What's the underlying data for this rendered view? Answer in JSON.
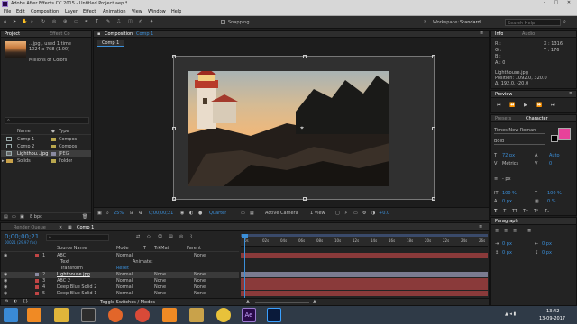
{
  "window": {
    "title": "Adobe After Effects CC 2015 - Untitled Project.aep *"
  },
  "menu": [
    "File",
    "Edit",
    "Composition",
    "Layer",
    "Effect",
    "Animation",
    "View",
    "Window",
    "Help"
  ],
  "toolbar": {
    "snapping": "Snapping",
    "workspace_label": "Workspace:",
    "workspace_value": "Standard",
    "search_placeholder": "Search Help"
  },
  "project": {
    "tabs": [
      "Project",
      "Effect Co"
    ],
    "asset_name": "...jpg , used 1 time",
    "asset_size": "1024 x 768 (1.00)",
    "asset_colors": "Millions of Colors",
    "columns": {
      "name": "Name",
      "type": "Type"
    },
    "items": [
      {
        "name": "Comp 1",
        "type": "Compos"
      },
      {
        "name": "Comp 2",
        "type": "Compos"
      },
      {
        "name": "Lighthou...jpg",
        "type": "JPEG"
      },
      {
        "name": "Solids",
        "type": "Folder"
      }
    ],
    "bpc": "8 bpc"
  },
  "composition": {
    "tab_label": "Composition",
    "tab_name": "Comp 1",
    "sub_tab": "Comp 1",
    "zoom": "25%",
    "timecode": "0;00;00;21",
    "resolution": "Quarter",
    "camera": "Active Camera",
    "view": "1 View",
    "exposure": "+0.0"
  },
  "info": {
    "tabs": [
      "Info",
      "Audio"
    ],
    "r": "R :",
    "g": "G :",
    "b": "B :",
    "a": "A : 0",
    "x": "X : 1316",
    "y": "Y : 176",
    "layer": "Lighthouse.jpg",
    "position": "Position: 1092.0, 320.0",
    "delta": "Δ: 192.0, -20.0"
  },
  "preview": {
    "tab": "Preview"
  },
  "character": {
    "tabs": [
      "Presets",
      "Character"
    ],
    "font": "Times New Roman",
    "style": "Bold",
    "size": "72 px",
    "leading": "Auto",
    "kerning": "Metrics",
    "tracking": "0",
    "stroke": "- px",
    "vscale": "100 %",
    "hscale": "100 %",
    "baseline": "0 px",
    "tsume": "0 %"
  },
  "paragraph": {
    "tab": "Paragraph",
    "indent_left": "0 px",
    "indent_right": "0 px",
    "space_before": "0 px",
    "space_after": "0 px"
  },
  "timeline": {
    "tabs": [
      "Render Queue",
      "Comp 1"
    ],
    "timecode": "0;00;00;21",
    "fps": "00021 (29.97 fps)",
    "columns": {
      "source": "Source Name",
      "mode": "Mode",
      "t": "T",
      "trkmat": "TrkMat",
      "parent": "Parent"
    },
    "layers": [
      {
        "num": "1",
        "name": "ABC",
        "mode": "Normal",
        "trkmat": "",
        "parent": "None",
        "color": "#c04545"
      },
      {
        "num": "",
        "name": "Text",
        "mode": "",
        "trkmat": "",
        "parent": "Animate:",
        "color": ""
      },
      {
        "num": "",
        "name": "Transform",
        "mode": "Reset",
        "trkmat": "",
        "parent": "",
        "color": ""
      },
      {
        "num": "2",
        "name": "Lighthouse.jpg",
        "mode": "Normal",
        "trkmat": "None",
        "parent": "None",
        "color": "#8a8aa0"
      },
      {
        "num": "3",
        "name": "ABC 2",
        "mode": "Normal",
        "trkmat": "None",
        "parent": "None",
        "color": "#c04545"
      },
      {
        "num": "4",
        "name": "Deep Blue Solid 2",
        "mode": "Normal",
        "trkmat": "None",
        "parent": "None",
        "color": "#c04545"
      },
      {
        "num": "5",
        "name": "Deep Blue Solid 1",
        "mode": "Normal",
        "trkmat": "None",
        "parent": "None",
        "color": "#c04545"
      }
    ],
    "ruler": [
      "0s",
      "02s",
      "04s",
      "06s",
      "08s",
      "10s",
      "12s",
      "14s",
      "16s",
      "18s",
      "20s",
      "22s",
      "24s",
      "26s"
    ],
    "toggle_label": "Toggle Switches / Modes"
  },
  "taskbar": {
    "time": "13:42",
    "date": "13-09-2017"
  }
}
